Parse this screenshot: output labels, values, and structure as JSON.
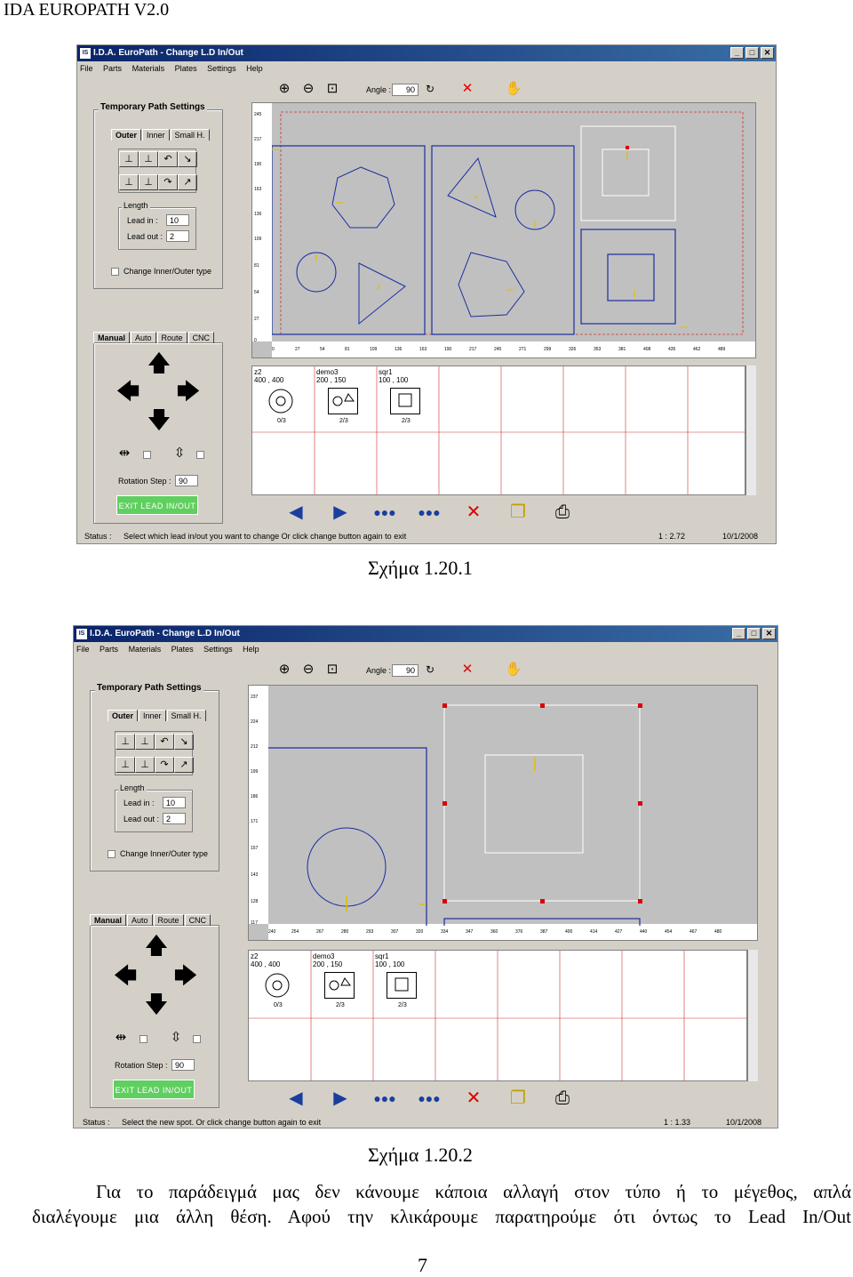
{
  "header": "IDA EUROPATH V2.0",
  "captions": {
    "fig1": "Σχήμα 1.20.1",
    "fig2": "Σχήμα 1.20.2"
  },
  "paragraph": {
    "line1": "Για το παράδειγμά μας δεν κάνουμε κάποια αλλαγή στον τύπο ή το μέγεθος, απλά",
    "line2": "διαλέγουμε μια άλλη θέση. Αφού την κλικάρουμε παρατηρούμε ότι όντως το Lead In/Out"
  },
  "page_number": "7",
  "window": {
    "title": "I.D.A. EuroPath - Change L.D In/Out",
    "app_icon": "IS",
    "menu": [
      "File",
      "Parts",
      "Materials",
      "Plates",
      "Settings",
      "Help"
    ],
    "angle_label": "Angle :",
    "angle_value": "90",
    "panel_title": "Temporary Path Settings",
    "tabs_top": [
      "Outer",
      "Inner",
      "Small H."
    ],
    "length_title": "Length",
    "lead_in_label": "Lead in :",
    "lead_in_value": "10",
    "lead_out_label": "Lead out :",
    "lead_out_value": "2",
    "change_type_label": "Change Inner/Outer type",
    "tabs_bottom": [
      "Manual",
      "Auto",
      "Route",
      "CNC"
    ],
    "rotation_label": "Rotation Step :",
    "rotation_value": "90",
    "exit_label": "EXIT LEAD IN/OUT",
    "status_label": "Status :",
    "plates": [
      {
        "name": "z2",
        "size": "400 , 400",
        "count": "0/3"
      },
      {
        "name": "demo3",
        "size": "200 , 150",
        "count": "2/3"
      },
      {
        "name": "sqr1",
        "size": "100 , 100",
        "count": "2/3"
      }
    ]
  },
  "screens": [
    {
      "status_text": "Select which lead in/out you want to change Or click change button again to exit",
      "scale": "1 : 2.72",
      "date": "10/1/2008",
      "y_ticks": [
        "245",
        "217",
        "190",
        "163",
        "136",
        "109",
        "81",
        "54",
        "27",
        "0"
      ],
      "x_ticks": [
        "0",
        "27",
        "54",
        "81",
        "109",
        "136",
        "163",
        "190",
        "217",
        "245",
        "271",
        "299",
        "326",
        "353",
        "381",
        "408",
        "435",
        "462",
        "489"
      ]
    },
    {
      "status_text": "Select the new spot. Or click change button again to exit",
      "scale": "1 : 1.33",
      "date": "10/1/2008",
      "y_ticks": [
        "237",
        "224",
        "212",
        "199",
        "186",
        "171",
        "157",
        "143",
        "128",
        "117"
      ],
      "x_ticks": [
        "240",
        "254",
        "267",
        "280",
        "293",
        "307",
        "320",
        "334",
        "347",
        "360",
        "376",
        "387",
        "400",
        "414",
        "427",
        "440",
        "454",
        "467",
        "480"
      ]
    }
  ],
  "icons": {
    "zoom_in": "zoom-in-icon",
    "zoom_out": "zoom-out-icon",
    "zoom_fit": "zoom-fit-icon",
    "rotate": "rotate-icon",
    "delete": "delete-icon",
    "hand": "hand-icon",
    "prev": "prev-icon",
    "next": "next-icon",
    "copy": "copy-icon",
    "print": "print-icon"
  }
}
